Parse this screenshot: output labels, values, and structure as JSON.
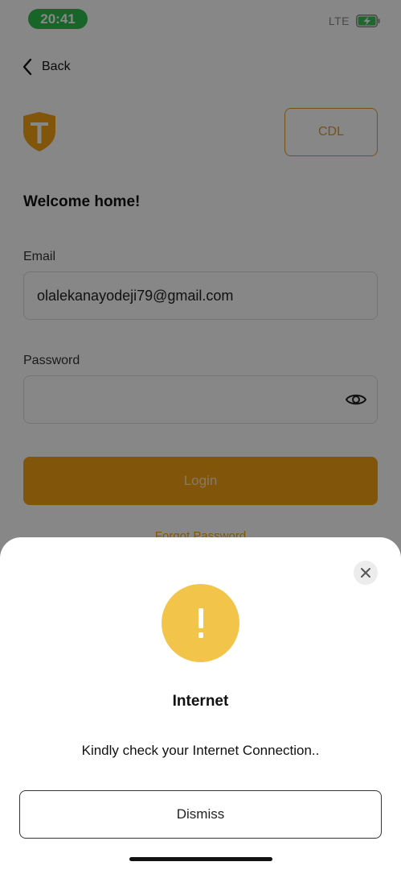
{
  "status_bar": {
    "time": "20:41",
    "network": "LTE",
    "battery_icon": "battery-charging-icon"
  },
  "nav": {
    "back_label": "Back",
    "back_icon": "chevron-left-icon"
  },
  "header": {
    "logo_letter": "T",
    "cdl_label": "CDL"
  },
  "login": {
    "welcome": "Welcome home!",
    "email_label": "Email",
    "email_value": "olalekanayodeji79@gmail.com",
    "password_label": "Password",
    "password_value": "",
    "password_toggle_icon": "eye-icon",
    "login_label": "Login",
    "forgot_label": "Forgot Password"
  },
  "dialog": {
    "icon": "exclamation-icon",
    "title": "Internet",
    "message": "Kindly check your Internet Connection..",
    "dismiss_label": "Dismiss",
    "close_icon": "close-icon"
  },
  "colors": {
    "accent": "#f3a113",
    "status_time_bg": "#2fbf4f",
    "alert_icon_bg": "#f2c54a",
    "overlay": "rgba(0,0,0,0.47)"
  }
}
